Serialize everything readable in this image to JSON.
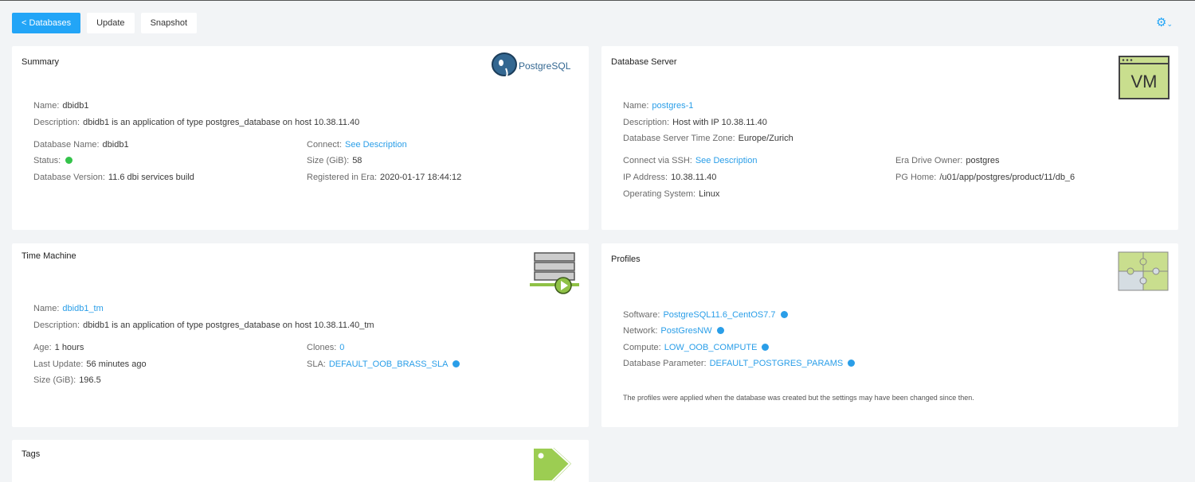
{
  "toolbar": {
    "back_label": "< Databases",
    "update_label": "Update",
    "snapshot_label": "Snapshot"
  },
  "summary": {
    "title": "Summary",
    "logo_text": "PostgreSQL",
    "name_label": "Name:",
    "name": "dbidb1",
    "description_label": "Description:",
    "description": "dbidb1 is an application of type postgres_database on host 10.38.11.40",
    "db_name_label": "Database Name:",
    "db_name": "dbidb1",
    "status_label": "Status:",
    "status_color": "#34c34a",
    "version_label": "Database Version:",
    "version": "11.6 dbi services build",
    "connect_label": "Connect:",
    "connect_link": "See Description",
    "size_label": "Size (GiB):",
    "size": "58",
    "registered_label": "Registered in Era:",
    "registered": "2020-01-17 18:44:12"
  },
  "db_server": {
    "title": "Database Server",
    "logo_text": "VM",
    "name_label": "Name:",
    "name": "postgres-1",
    "description_label": "Description:",
    "description": "Host with IP 10.38.11.40",
    "timezone_label": "Database Server Time Zone:",
    "timezone": "Europe/Zurich",
    "ssh_label": "Connect via SSH:",
    "ssh_link": "See Description",
    "ip_label": "IP Address:",
    "ip": "10.38.11.40",
    "os_label": "Operating System:",
    "os": "Linux",
    "drive_owner_label": "Era Drive Owner:",
    "drive_owner": "postgres",
    "pg_home_label": "PG Home:",
    "pg_home": "/u01/app/postgres/product/11/db_6"
  },
  "time_machine": {
    "title": "Time Machine",
    "name_label": "Name:",
    "name": "dbidb1_tm",
    "description_label": "Description:",
    "description": "dbidb1 is an application of type postgres_database on host 10.38.11.40_tm",
    "age_label": "Age:",
    "age": "1 hours",
    "last_update_label": "Last Update:",
    "last_update": "56 minutes ago",
    "size_label": "Size (GiB):",
    "size": "196.5",
    "clones_label": "Clones:",
    "clones": "0",
    "sla_label": "SLA:",
    "sla": "DEFAULT_OOB_BRASS_SLA"
  },
  "profiles": {
    "title": "Profiles",
    "software_label": "Software:",
    "software": "PostgreSQL11.6_CentOS7.7",
    "network_label": "Network:",
    "network": "PostGresNW",
    "compute_label": "Compute:",
    "compute": "LOW_OOB_COMPUTE",
    "db_param_label": "Database Parameter:",
    "db_param": "DEFAULT_POSTGRES_PARAMS",
    "note": "The profiles were applied when the database was created but the settings may have been changed since then."
  },
  "tags": {
    "title": "Tags"
  },
  "colors": {
    "accent": "#22a5f7",
    "link": "#2a9ee8",
    "icon_green": "#8fc146"
  }
}
